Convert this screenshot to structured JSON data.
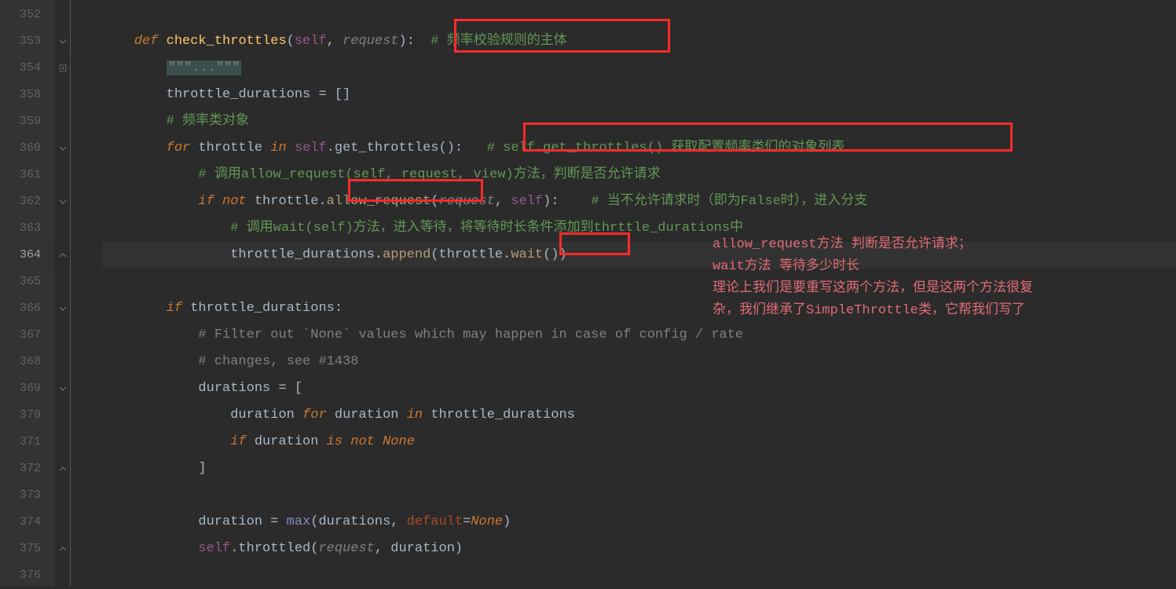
{
  "gutter": {
    "lines": [
      "352",
      "353",
      "354",
      "358",
      "359",
      "360",
      "361",
      "362",
      "363",
      "364",
      "365",
      "366",
      "367",
      "368",
      "369",
      "370",
      "371",
      "372",
      "373",
      "374",
      "375",
      "376"
    ],
    "highlight": "364"
  },
  "code": {
    "l353_def": "def ",
    "l353_fn": "check_throttles",
    "l353_open": "(",
    "l353_self": "self",
    "l353_comma": ", ",
    "l353_req": "request",
    "l353_close": "):",
    "l353_cmt": "  # 频率校验规则的主体",
    "l354_doc": "\"\"\"...\"\"\"",
    "l358": "throttle_durations = []",
    "l359": "# 频率类对象",
    "l360_for": "for ",
    "l360_var": "throttle ",
    "l360_in": "in ",
    "l360_self": "self",
    "l360_call": ".get_throttles():",
    "l360_cmt": "   # self.get_throttles() 获取配置频率类们的对象列表",
    "l361": "# 调用allow_request(self, request, view)方法，判断是否允许请求",
    "l362_if": "if ",
    "l362_not": "not ",
    "l362_t": "throttle.",
    "l362_ar": "allow_request",
    "l362_op": "(",
    "l362_req": "request",
    "l362_c": ", ",
    "l362_self": "self",
    "l362_cl": "):",
    "l362_cmt": "    # 当不允许请求时（即为False时），进入分支",
    "l363": "# 调用wait(self)方法，进入等待，将等待时长条件添加到thrttle_durations中",
    "l364_a": "throttle_durations.",
    "l364_ap": "append",
    "l364_b": "(throttle.",
    "l364_w": "wait",
    "l364_c": "())",
    "l366_if": "if ",
    "l366_t": "throttle_durations:",
    "l367": "# Filter out `None` values which may happen in case of config / rate",
    "l368": "# changes, see #1438",
    "l369": "durations = [",
    "l370_a": "duration ",
    "l370_for": "for ",
    "l370_b": "duration ",
    "l370_in": "in ",
    "l370_c": "throttle_durations",
    "l371_if": "if ",
    "l371_a": "duration ",
    "l371_is": "is not ",
    "l371_none": "None",
    "l372": "]",
    "l374_a": "duration = ",
    "l374_max": "max",
    "l374_b": "(durations, ",
    "l374_def": "default",
    "l374_eq": "=",
    "l374_none": "None",
    "l374_c": ")",
    "l375_self": "self",
    "l375_a": ".throttled(",
    "l375_req": "request",
    "l375_b": ", duration)"
  },
  "annotations": {
    "a1": "allow_request方法 判断是否允许请求；",
    "a2": "wait方法 等待多少时长",
    "a3": "理论上我们是要重写这两个方法，但是这两个方法很复",
    "a4": "杂，我们继承了SimpleThrottle类，它帮我们写了"
  }
}
